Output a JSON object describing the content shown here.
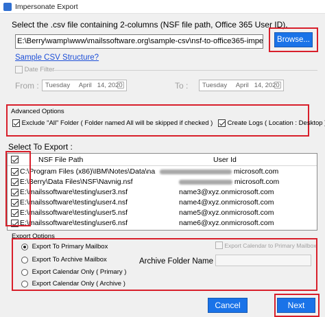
{
  "window": {
    "title": "Impersonate Export"
  },
  "csv": {
    "prompt": "Select the .csv file containing 2-columns (NSF file path, Office 365 User ID).",
    "path_value": "E:\\Berry\\wamp\\www\\mailssoftware.org\\sample-csv\\nsf-to-office365-imperso",
    "browse_label": "Browse...",
    "sample_link": "Sample CSV Structure?"
  },
  "date_filter": {
    "label": "Date Filter",
    "from_label": "From :",
    "to_label": "To :",
    "from": {
      "weekday": "Tuesday",
      "month": "April",
      "day_year": "14, 2020"
    },
    "to": {
      "weekday": "Tuesday",
      "month": "April",
      "day_year": "14, 2020"
    }
  },
  "advanced": {
    "legend": "Advanced Options",
    "exclude_label": "Exclude \"All\" Folder ( Folder named All will be skipped if checked )",
    "logs_label": "Create Logs ( Location : Desktop )"
  },
  "select_export": {
    "heading": "Select To Export :",
    "col_path": "NSF File Path",
    "col_user": "User Id",
    "rows": [
      {
        "path": "C:\\Program Files (x86)\\IBM\\Notes\\Data\\nam...",
        "user_suffix": "microsoft.com"
      },
      {
        "path": "E:\\Berry\\Data Files\\NSF\\Navnig.nsf",
        "user_suffix": "microsoft.com"
      },
      {
        "path": "E:\\mailssoftware\\testing\\user3.nsf",
        "user": "name3@xyz.onmicrosoft.com"
      },
      {
        "path": "E:\\mailssoftware\\testing\\user4.nsf",
        "user": "name4@xyz.onmicrosoft.com"
      },
      {
        "path": "E:\\mailssoftware\\testing\\user5.nsf",
        "user": "name5@xyz.onmicrosoft.com"
      },
      {
        "path": "E:\\mailssoftware\\testing\\user6.nsf",
        "user": "name6@xyz.onmicrosoft.com"
      }
    ]
  },
  "export_options": {
    "legend": "Export Options",
    "opt1": "Export To Primary Mailbox",
    "opt2": "Export To Archive Mailbox",
    "opt3": "Export  Calendar Only ( Primary )",
    "opt4": "Export  Calendar Only ( Archive )",
    "calendar_primary": "Export Calendar to Primary Mailbox",
    "archive_folder_label": "Archive Folder Name :"
  },
  "footer": {
    "cancel_label": "Cancel",
    "next_label": "Next"
  },
  "colors": {
    "accent": "#1a73e8",
    "highlight": "#d81e2a",
    "link": "#1d4fd8"
  }
}
